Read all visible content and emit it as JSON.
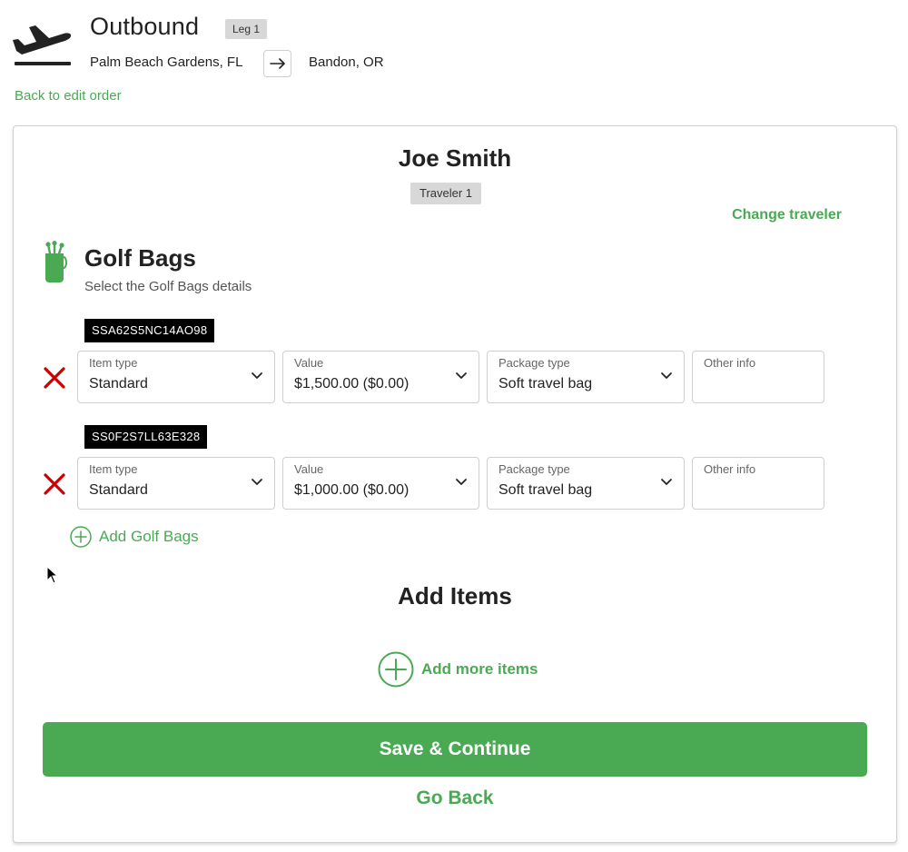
{
  "header": {
    "title": "Outbound",
    "leg_badge": "Leg 1",
    "origin": "Palm Beach Gardens, FL",
    "destination": "Bandon, OR",
    "back_link": "Back to edit order"
  },
  "traveler": {
    "name": "Joe Smith",
    "badge": "Traveler 1",
    "change_label": "Change traveler"
  },
  "section": {
    "title": "Golf Bags",
    "subtitle": "Select the Golf Bags details",
    "items": [
      {
        "code": "SSA62S5NC14AO98",
        "item_type_label": "Item type",
        "item_type_value": "Standard",
        "value_label": "Value",
        "value_value": "$1,500.00 ($0.00)",
        "package_label": "Package type",
        "package_value": "Soft travel bag",
        "other_label": "Other info",
        "other_value": ""
      },
      {
        "code": "SS0F2S7LL63E328",
        "item_type_label": "Item type",
        "item_type_value": "Standard",
        "value_label": "Value",
        "value_value": "$1,000.00 ($0.00)",
        "package_label": "Package type",
        "package_value": "Soft travel bag",
        "other_label": "Other info",
        "other_value": ""
      }
    ],
    "add_label": "Add Golf Bags"
  },
  "add_items": {
    "title": "Add Items",
    "add_more_label": "Add more items"
  },
  "actions": {
    "save_label": "Save & Continue",
    "go_back_label": "Go Back"
  },
  "icons": {
    "plane": "plane-departure-icon",
    "arrow": "arrow-right-icon",
    "golf_bag": "golf-bag-icon",
    "remove": "close-x-icon",
    "chevron": "chevron-down-icon",
    "add": "plus-circle-icon"
  },
  "colors": {
    "accent": "#4aaa54",
    "remove": "#cc0000",
    "badge_bg": "#d8d8d8",
    "code_bg": "#000000"
  }
}
